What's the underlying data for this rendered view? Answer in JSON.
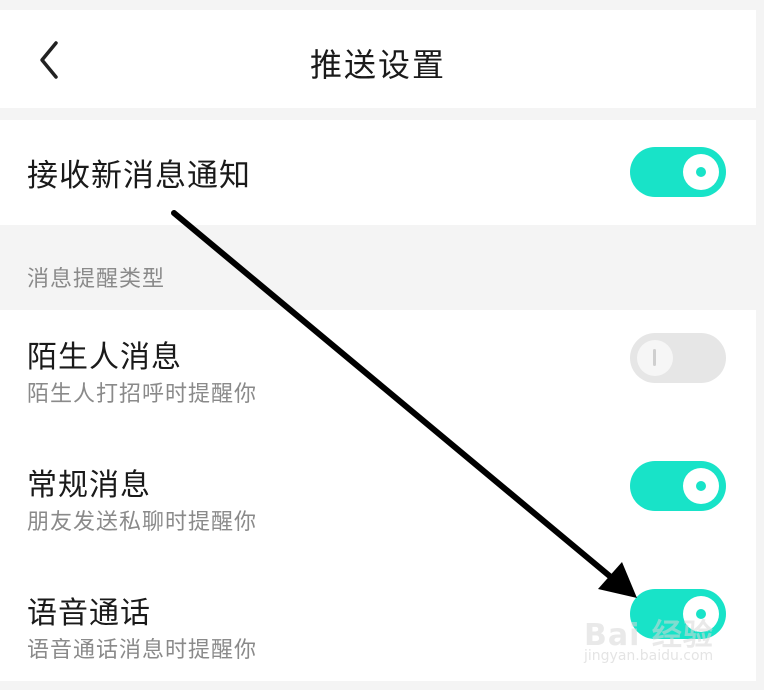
{
  "header": {
    "title": "推送设置",
    "back_icon": "chevron-left-icon"
  },
  "main_setting": {
    "label": "接收新消息通知",
    "enabled": true
  },
  "section": {
    "label": "消息提醒类型"
  },
  "items": [
    {
      "title": "陌生人消息",
      "subtitle": "陌生人打招呼时提醒你",
      "enabled": false
    },
    {
      "title": "常规消息",
      "subtitle": "朋友发送私聊时提醒你",
      "enabled": true
    },
    {
      "title": "语音通话",
      "subtitle": "语音通话消息时提醒你",
      "enabled": true
    }
  ],
  "colors": {
    "toggle_on": "#18e3c8",
    "toggle_off": "#e6e6e6",
    "background": "#f4f4f4"
  },
  "watermark": {
    "text": "Bai  经验",
    "url_text": "jingyan.baidu.com"
  }
}
